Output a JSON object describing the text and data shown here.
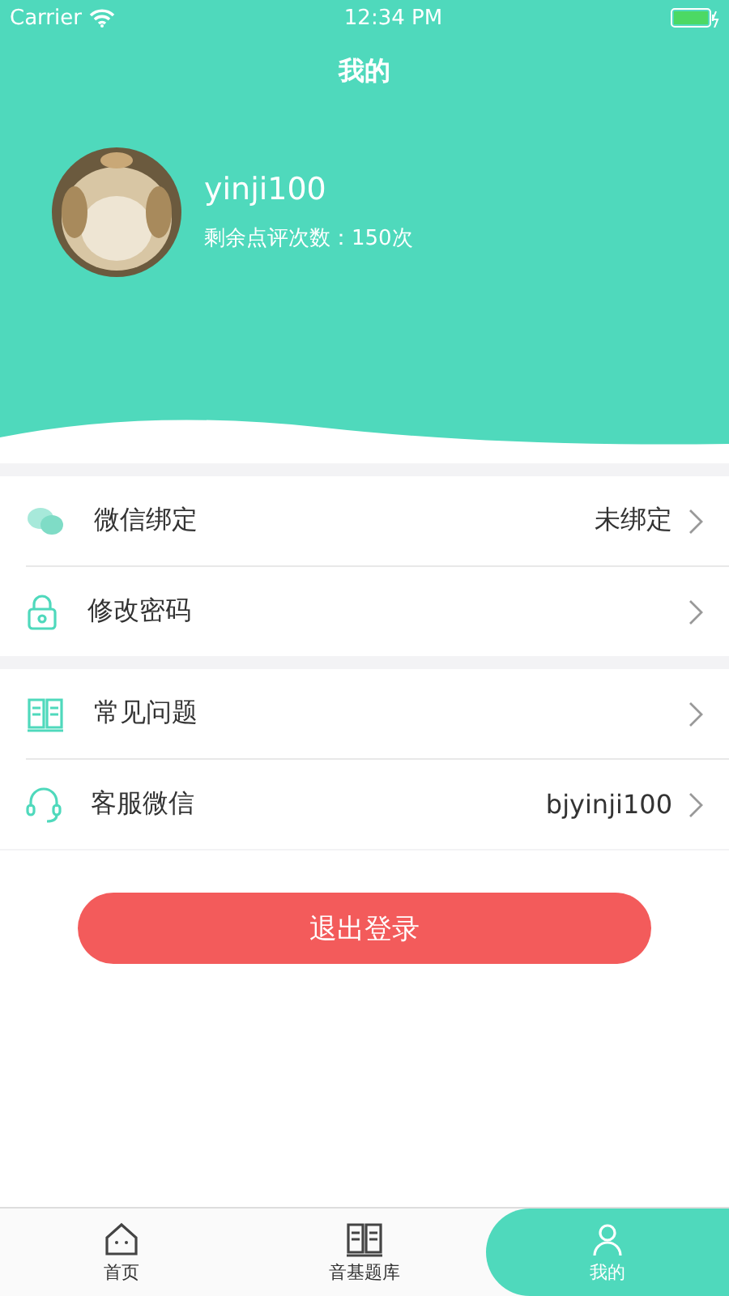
{
  "status_bar": {
    "carrier": "Carrier",
    "time": "12:34 PM"
  },
  "header": {
    "title": "我的"
  },
  "profile": {
    "username": "yinji100",
    "remaining": "剩余点评次数：150次"
  },
  "sections": [
    {
      "items": [
        {
          "kind": "chat",
          "label": "微信绑定",
          "value": "未绑定"
        },
        {
          "kind": "lock",
          "label": "修改密码"
        }
      ]
    },
    {
      "items": [
        {
          "kind": "book",
          "label": "常见问题"
        },
        {
          "kind": "headset",
          "label": "客服微信",
          "value": "bjyinji100"
        }
      ]
    }
  ],
  "logout_button": "退出登录",
  "tab_bar": [
    {
      "kind": "home",
      "label": "首页",
      "selected": false
    },
    {
      "kind": "book",
      "label": "音基题库",
      "selected": false
    },
    {
      "kind": "user",
      "label": "我的",
      "selected": true
    }
  ]
}
